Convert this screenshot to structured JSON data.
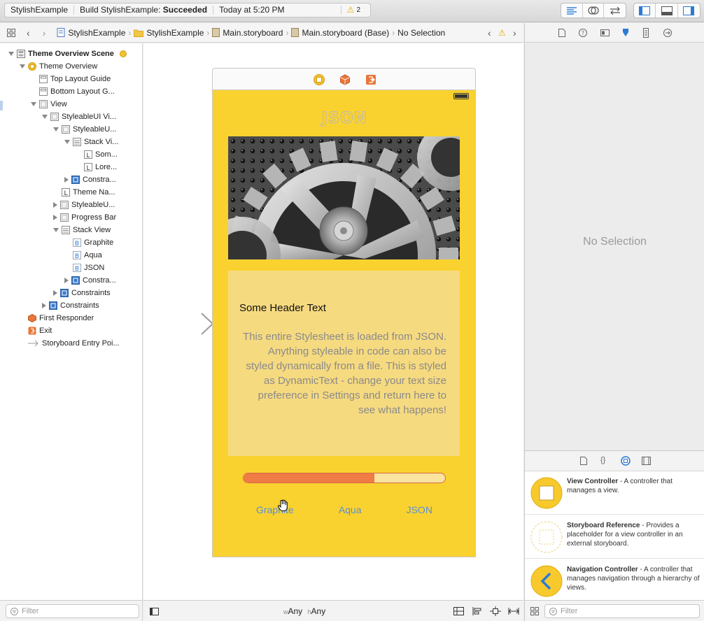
{
  "status": {
    "project": "StylishExample",
    "build_prefix": "Build StylishExample:",
    "build_result": "Succeeded",
    "time": "Today at 5:20 PM",
    "warnings": "2"
  },
  "breadcrumb": [
    "StylishExample",
    "StylishExample",
    "Main.storyboard",
    "Main.storyboard (Base)",
    "No Selection"
  ],
  "tree": [
    {
      "label": "Theme Overview Scene",
      "depth": 0,
      "tri": "down",
      "icon": "scene-icon",
      "bold": true
    },
    {
      "label": "Theme Overview",
      "depth": 1,
      "tri": "down",
      "icon": "view-controller-icon"
    },
    {
      "label": "Top Layout Guide",
      "depth": 2,
      "tri": "",
      "icon": "layout-guide-icon"
    },
    {
      "label": "Bottom Layout G...",
      "depth": 2,
      "tri": "",
      "icon": "layout-guide-icon"
    },
    {
      "label": "View",
      "depth": 2,
      "tri": "down",
      "icon": "view-icon"
    },
    {
      "label": "StyleableUI Vi...",
      "depth": 3,
      "tri": "down",
      "icon": "view-icon"
    },
    {
      "label": "StyleableU...",
      "depth": 4,
      "tri": "down",
      "icon": "view-icon"
    },
    {
      "label": "Stack Vi...",
      "depth": 5,
      "tri": "down",
      "icon": "stack-view-icon"
    },
    {
      "label": "Som...",
      "depth": 6,
      "tri": "",
      "icon": "label-icon"
    },
    {
      "label": "Lore...",
      "depth": 6,
      "tri": "",
      "icon": "label-icon"
    },
    {
      "label": "Constra...",
      "depth": 5,
      "tri": "right",
      "icon": "constraints-icon"
    },
    {
      "label": "Theme Na...",
      "depth": 4,
      "tri": "",
      "icon": "label-icon"
    },
    {
      "label": "StyleableU...",
      "depth": 4,
      "tri": "right",
      "icon": "view-icon"
    },
    {
      "label": "Progress Bar",
      "depth": 4,
      "tri": "right",
      "icon": "view-icon"
    },
    {
      "label": "Stack View",
      "depth": 4,
      "tri": "down",
      "icon": "stack-view-icon"
    },
    {
      "label": "Graphite",
      "depth": 5,
      "tri": "",
      "icon": "button-icon"
    },
    {
      "label": "Aqua",
      "depth": 5,
      "tri": "",
      "icon": "button-icon"
    },
    {
      "label": "JSON",
      "depth": 5,
      "tri": "",
      "icon": "button-icon"
    },
    {
      "label": "Constra...",
      "depth": 5,
      "tri": "right",
      "icon": "constraints-icon"
    },
    {
      "label": "Constraints",
      "depth": 4,
      "tri": "right",
      "icon": "constraints-icon"
    },
    {
      "label": "Constraints",
      "depth": 3,
      "tri": "right",
      "icon": "constraints-icon"
    },
    {
      "label": "First Responder",
      "depth": 1,
      "tri": "",
      "icon": "first-responder-icon"
    },
    {
      "label": "Exit",
      "depth": 1,
      "tri": "",
      "icon": "exit-icon"
    },
    {
      "label": "Storyboard Entry Poi...",
      "depth": 1,
      "tri": "",
      "icon": "entry-point-icon"
    }
  ],
  "navigator": {
    "filter_placeholder": "Filter"
  },
  "scene": {
    "theme_title": "JSON",
    "header_text": "Some Header Text",
    "body_text": "This entire Stylesheet is loaded from JSON. Anything styleable in code can also be styled dynamically from a file. This is styled as DynamicText - change your text size preference in Settings and return here to see what happens!",
    "progress": 0.65,
    "buttons": [
      "Graphite",
      "Aqua",
      "JSON"
    ]
  },
  "size_class": {
    "w_prefix": "w",
    "w_value": "Any",
    "h_prefix": "h",
    "h_value": "Any"
  },
  "inspector": {
    "empty_text": "No Selection"
  },
  "library": {
    "items": [
      {
        "name": "View Controller",
        "desc": " - A controller that manages a view."
      },
      {
        "name": "Storyboard Reference",
        "desc": " - Provides a placeholder for a view controller in an external storyboard."
      },
      {
        "name": "Navigation Controller",
        "desc": " - A controller that manages navigation through a hierarchy of views."
      }
    ],
    "filter_placeholder": "Filter"
  },
  "colors": {
    "accent": "#2b7bd6",
    "scene_yellow": "#fad22f",
    "progress_fill": "#ef7b45",
    "progress_track": "#fbe4a0",
    "button_blue": "#5b8fd6"
  }
}
